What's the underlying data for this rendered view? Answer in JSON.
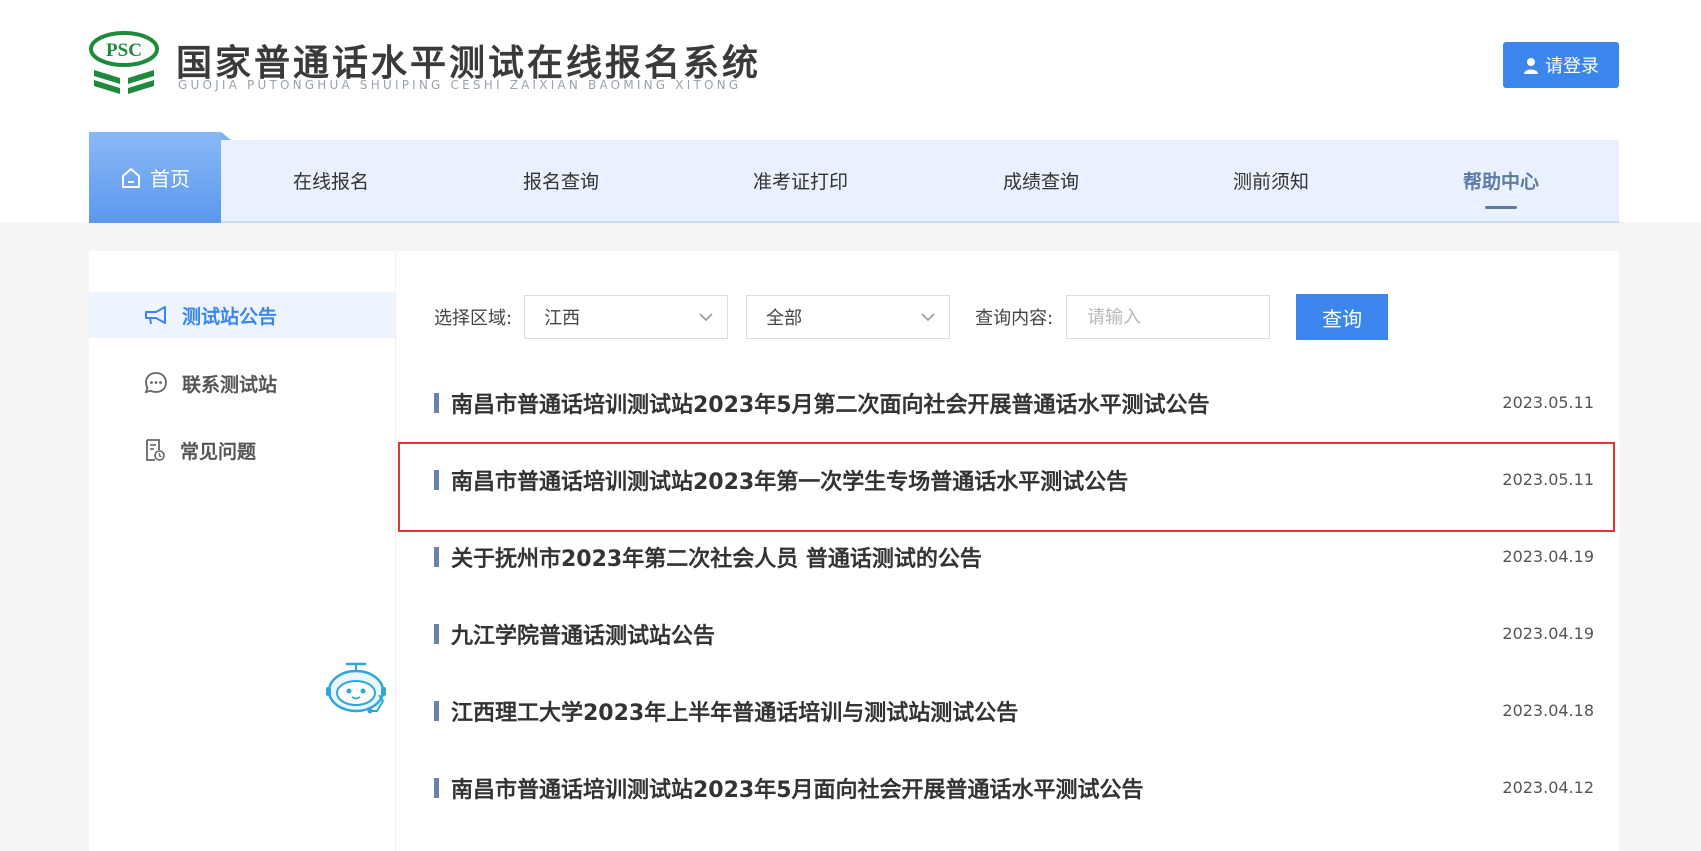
{
  "header": {
    "logo_mark_text": "PSC",
    "title": "国家普通话水平测试在线报名系统",
    "subtitle": "GUOJIA PUTONGHUA SHUIPING CESHI ZAIXIAN BAOMING XITONG",
    "login_label": "请登录"
  },
  "nav": {
    "home": "首页",
    "items": [
      "在线报名",
      "报名查询",
      "准考证打印",
      "成绩查询",
      "测前须知",
      "帮助中心"
    ],
    "active": "帮助中心"
  },
  "sidebar": {
    "items": [
      {
        "label": "测试站公告",
        "icon": "megaphone-icon",
        "active": true
      },
      {
        "label": "联系测试站",
        "icon": "chat-icon",
        "active": false
      },
      {
        "label": "常见问题",
        "icon": "faq-icon",
        "active": false
      }
    ]
  },
  "filter": {
    "region_label": "选择区域:",
    "region_value": "江西",
    "scope_value": "全部",
    "query_label": "查询内容:",
    "query_placeholder": "请输入",
    "search_label": "查询"
  },
  "announcements": [
    {
      "title": "南昌市普通话培训测试站2023年5月第二次面向社会开展普通话水平测试公告",
      "date": "2023.05.11"
    },
    {
      "title": "南昌市普通话培训测试站2023年第一次学生专场普通话水平测试公告",
      "date": "2023.05.11",
      "highlighted": true
    },
    {
      "title": "关于抚州市2023年第二次社会人员 普通话测试的公告",
      "date": "2023.04.19"
    },
    {
      "title": "九江学院普通话测试站公告",
      "date": "2023.04.19"
    },
    {
      "title": "江西理工大学2023年上半年普通话培训与测试站测试公告",
      "date": "2023.04.18"
    },
    {
      "title": "南昌市普通话培训测试站2023年5月面向社会开展普通话水平测试公告",
      "date": "2023.04.12"
    }
  ],
  "colors": {
    "accent": "#3b86ec",
    "nav_bg": "#e8f1fd",
    "highlight_border": "#e03636",
    "help_text": "#5d7aa6"
  }
}
